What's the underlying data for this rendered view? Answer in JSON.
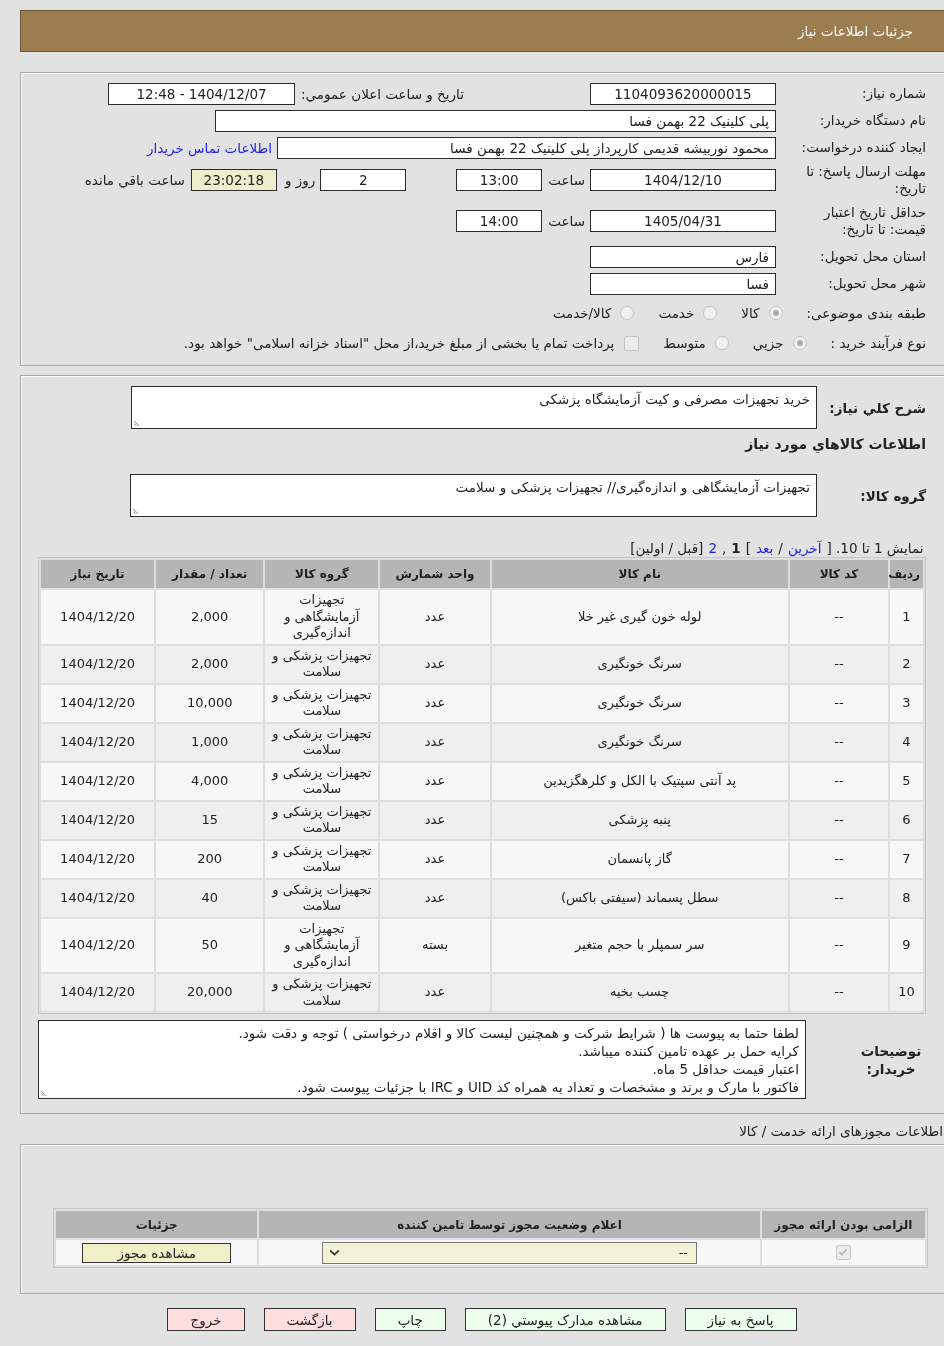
{
  "header": {
    "title": "جزئیات اطلاعات نیاز"
  },
  "request": {
    "need_number": {
      "label": "شماره نیاز:",
      "value": "1104093620000015"
    },
    "announcement": {
      "label": "تاریخ و ساعت اعلان عمومي:",
      "value": "1404/12/07 - 12:48"
    },
    "buyer_org": {
      "label": "نام دستگاه خریدار:",
      "value": "پلی کلینیک 22 بهمن فسا"
    },
    "requester": {
      "label": "ایجاد کننده درخواست:",
      "value": "محمود نوربیشه قدیمی کارپرداز پلی کلینیک 22 بهمن فسا",
      "contact_link": "اطلاعات تماس خریدار"
    },
    "reply_deadline": {
      "label": "مهلت ارسال پاسخ: تا تاریخ:",
      "date": "1404/12/10",
      "time_label": "ساعت",
      "time": "13:00",
      "days": "2",
      "days_label": "روز و",
      "remaining": "23:02:18",
      "remaining_label": "ساعت باقي مانده"
    },
    "price_validity": {
      "label": "حداقل تاریخ اعتبار قیمت: تا تاریخ:",
      "date": "1405/04/31",
      "time_label": "ساعت",
      "time": "14:00"
    },
    "province": {
      "label": "استان محل تحویل:",
      "value": "فارس"
    },
    "city": {
      "label": "شهر محل تحویل:",
      "value": "فسا"
    },
    "category": {
      "label": "طبقه بندی موضوعی:",
      "options": [
        {
          "label": "کالا",
          "selected": true,
          "disabled": true
        },
        {
          "label": "خدمت",
          "selected": false,
          "disabled": true
        },
        {
          "label": "کالا/خدمت",
          "selected": false,
          "disabled": true
        }
      ]
    },
    "purchase_type": {
      "label": "نوع فرآیند خرید :",
      "options": [
        {
          "label": "جزيي",
          "selected": true,
          "disabled": true
        },
        {
          "label": "متوسط",
          "selected": false,
          "disabled": true
        }
      ],
      "treasury_payment": {
        "label": "پرداخت تمام یا بخشی از مبلغ خرید،از محل \"اسناد خزانه اسلامی\" خواهد بود.",
        "checked": false,
        "disabled": true
      }
    }
  },
  "needs": {
    "summary": {
      "label": "شرح کلي نیاز:",
      "value": "خرید تجهیزات مصرفی و کیت آزمایشگاه پزشکی"
    },
    "items_heading": "اطلاعات کالاهاي مورد نیاز",
    "goods_group": {
      "label": "گروه کالا:",
      "value": "تجهیزات آزمایشگاهی و اندازه‌گیری// تجهیزات پزشکی و سلامت"
    },
    "pagination": [
      {
        "kind": "text",
        "text": "نمایش 1 تا 10. ["
      },
      {
        "kind": "link",
        "text": "آخرین"
      },
      {
        "kind": "text",
        "text": "/"
      },
      {
        "kind": "link",
        "text": "بعد"
      },
      {
        "kind": "text",
        "text": "]"
      },
      {
        "kind": "link",
        "text": "2"
      },
      {
        "kind": "text",
        "text": ","
      },
      {
        "kind": "current",
        "text": "1"
      },
      {
        "kind": "text",
        "text": "[قبل / اولین]"
      }
    ],
    "table": {
      "columns": [
        "ردیف",
        "کد کالا",
        "نام کالا",
        "واحد شمارش",
        "گروه کالا",
        "تعداد / مقدار",
        "تاریخ نیاز"
      ],
      "rows": [
        [
          "1",
          "--",
          "لوله خون گیری غیر خلا",
          "عدد",
          "تجهیزات آزمایشگاهی و اندازه‌گیری",
          "2,000",
          "1404/12/20"
        ],
        [
          "2",
          "--",
          "سرنگ خونگیری",
          "عدد",
          "تجهیزات پزشکی و سلامت",
          "2,000",
          "1404/12/20"
        ],
        [
          "3",
          "--",
          "سرنگ خونگیری",
          "عدد",
          "تجهیزات پزشکی و سلامت",
          "10,000",
          "1404/12/20"
        ],
        [
          "4",
          "--",
          "سرنگ خونگیری",
          "عدد",
          "تجهیزات پزشکی و سلامت",
          "1,000",
          "1404/12/20"
        ],
        [
          "5",
          "--",
          "پد آنتی سپتیک با الکل و کلرهگزیدین",
          "عدد",
          "تجهیزات پزشکی و سلامت",
          "4,000",
          "1404/12/20"
        ],
        [
          "6",
          "--",
          "پنبه پزشکی",
          "عدد",
          "تجهیزات پزشکی و سلامت",
          "15",
          "1404/12/20"
        ],
        [
          "7",
          "--",
          "گاز پانسمان",
          "عدد",
          "تجهیزات پزشکی و سلامت",
          "200",
          "1404/12/20"
        ],
        [
          "8",
          "--",
          "سطل پسماند (سیفتی باکس)",
          "عدد",
          "تجهیزات پزشکی و سلامت",
          "40",
          "1404/12/20"
        ],
        [
          "9",
          "--",
          "سر سمپلر با حجم متغیر",
          "بسته",
          "تجهیزات آزمایشگاهی و اندازه‌گیری",
          "50",
          "1404/12/20"
        ],
        [
          "10",
          "--",
          "چسب بخیه",
          "عدد",
          "تجهیزات پزشکی و سلامت",
          "20,000",
          "1404/12/20"
        ]
      ]
    },
    "buyer_notes": {
      "label": "توضیحات خریدار:",
      "lines": [
        "لطفا حتما به پیوست ها ( شرایط شرکت و همچنین لیست کالا و اقلام درخواستی ) توجه و دقت شود.",
        "کرایه حمل بر عهده تامین کننده میباشد.",
        "اعتبار قیمت حداقل 5 ماه.",
        "فاکتور با مارک و برند و مشخصات و تعداد به همراه کد UID و IRC با جزئیات پیوست شود."
      ]
    }
  },
  "licenses": {
    "title": "اطلاعات مجوزهای ارائه خدمت / کالا",
    "columns": [
      "الزامی بودن ارائه مجوز",
      "اعلام وضعیت مجوز توسط تامین کننده",
      "جزئیات"
    ],
    "rows": [
      {
        "required": {
          "checked": true,
          "disabled": true
        },
        "status": "--",
        "details_button": "مشاهده مجوز"
      }
    ]
  },
  "actions": [
    {
      "label": "پاسخ به نیاز",
      "kind": "action"
    },
    {
      "label": "مشاهده مدارک پیوستي (2)",
      "kind": "action"
    },
    {
      "label": "چاپ",
      "kind": "action"
    },
    {
      "label": "بازگشت",
      "kind": "exit"
    },
    {
      "label": "خروج",
      "kind": "exit"
    }
  ]
}
